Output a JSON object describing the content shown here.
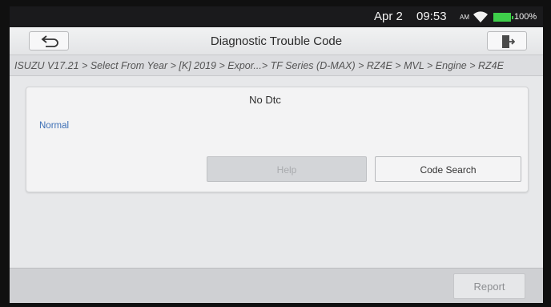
{
  "status_bar": {
    "date": "Apr 2",
    "time": "09:53",
    "ampm": "AM",
    "battery": "100%",
    "wifi_icon": "wifi-icon",
    "battery_icon": "battery-icon"
  },
  "header": {
    "title": "Diagnostic Trouble Code",
    "back_icon": "back-arrow-icon",
    "exit_icon": "exit-icon"
  },
  "breadcrumb": "ISUZU V17.21 > Select From Year > [K] 2019 > Expor...> TF Series (D-MAX) > RZ4E > MVL > Engine > RZ4E",
  "result": {
    "message": "No Dtc",
    "status": "Normal",
    "status_color": "#3d6fb5"
  },
  "actions": {
    "help_label": "Help",
    "code_search_label": "Code Search"
  },
  "footer": {
    "report_label": "Report"
  },
  "colors": {
    "battery_green": "#3ecf4a",
    "background": "#e7e8ea"
  }
}
